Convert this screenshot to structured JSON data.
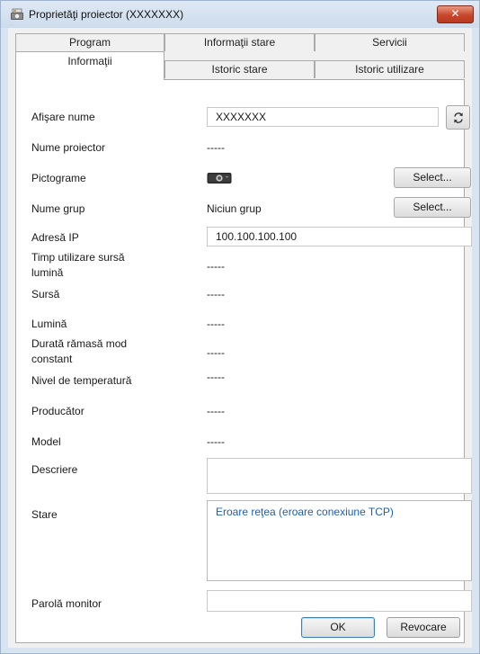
{
  "window": {
    "title": "Proprietăţi proiector (XXXXXXX)",
    "close_label": "✕"
  },
  "tabs": {
    "row1": [
      "Program",
      "Informaţii stare",
      "Servicii"
    ],
    "row2": [
      "Informaţii",
      "Istoric stare",
      "Istoric utilizare"
    ],
    "active": "Informaţii"
  },
  "fields": {
    "display_name": {
      "label": "Afişare nume",
      "value": "XXXXXXX"
    },
    "projector_name": {
      "label": "Nume proiector",
      "value": "-----"
    },
    "icons": {
      "label": "Pictograme",
      "button": "Select..."
    },
    "group_name": {
      "label": "Nume grup",
      "value": "Niciun grup",
      "button": "Select..."
    },
    "ip_address": {
      "label": "Adresă IP",
      "value": "100.100.100.100"
    },
    "light_usage_time": {
      "label_line1": "Timp utilizare sursă",
      "label_line2": "lumină",
      "value": "-----"
    },
    "source": {
      "label": "Sursă",
      "value": "-----"
    },
    "light": {
      "label": "Lumină",
      "value": "-----"
    },
    "remaining_constant": {
      "label_line1": "Durată rămasă mod",
      "label_line2": "constant",
      "value": "-----"
    },
    "temperature_level": {
      "label": "Nivel de temperatură",
      "value": "-----"
    },
    "manufacturer": {
      "label": "Producător",
      "value": "-----"
    },
    "model": {
      "label": "Model",
      "value": "-----"
    },
    "description": {
      "label": "Descriere",
      "value": ""
    },
    "status": {
      "label": "Stare",
      "value": "Eroare reţea (eroare conexiune TCP)"
    },
    "monitor_password": {
      "label": "Parolă monitor",
      "value": ""
    }
  },
  "buttons": {
    "ok": "OK",
    "cancel": "Revocare"
  },
  "colors": {
    "status_text": "#1c5fb0",
    "close_button": "#c7472b"
  },
  "icons": {
    "window": "projector-app-icon",
    "refresh": "refresh-icon",
    "projector": "projector-icon"
  }
}
